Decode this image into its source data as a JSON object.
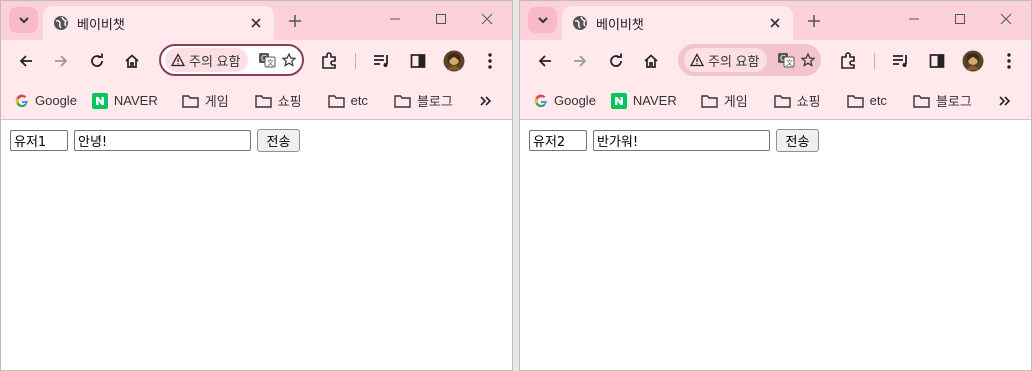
{
  "windows": {
    "left": {
      "tab_title": "베이비챗",
      "security_chip": "주의 요함",
      "bookmarks": [
        "Google",
        "NAVER",
        "게임",
        "쇼핑",
        "etc",
        "블로그"
      ],
      "user_value": "유저1",
      "message_value": "안녕!",
      "send_label": "전송"
    },
    "right": {
      "tab_title": "베이비챗",
      "security_chip": "주의 요함",
      "bookmarks": [
        "Google",
        "NAVER",
        "게임",
        "쇼핑",
        "etc",
        "블로그"
      ],
      "user_value": "유저2",
      "message_value": "반가워!",
      "send_label": "전송"
    }
  },
  "colors": {
    "titlebar": "#fdd1d9",
    "toolbar": "#ffe9ed",
    "omnibox_focus_border": "#8d3b57",
    "naver_green": "#03c75a"
  },
  "icons": [
    "chevron-down-icon",
    "globe-icon",
    "close-icon",
    "plus-icon",
    "minimize-icon",
    "maximize-icon",
    "back-icon",
    "forward-icon",
    "reload-icon",
    "home-icon",
    "warning-icon",
    "translate-icon",
    "star-icon",
    "extensions-icon",
    "reading-list-icon",
    "side-panel-icon",
    "avatar",
    "menu-icon",
    "google-icon",
    "naver-icon",
    "folder-icon",
    "double-chevron-icon"
  ]
}
